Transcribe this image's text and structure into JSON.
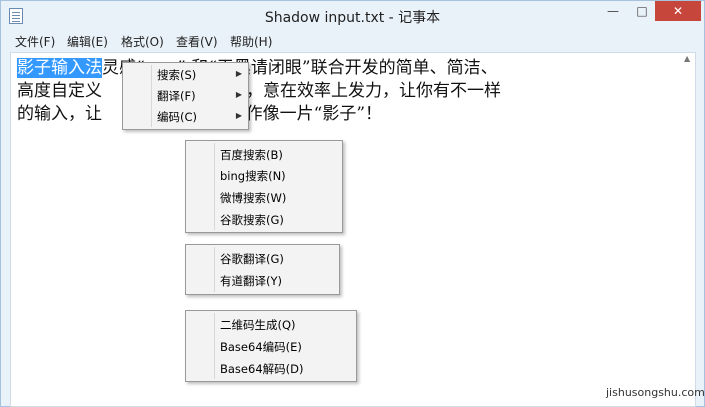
{
  "window": {
    "title": "Shadow input.txt - 记事本",
    "minimize": "—",
    "maximize": "□",
    "close": "✕"
  },
  "menubar": {
    "items": [
      "文件(F)",
      "编辑(E)",
      "格式(O)",
      "查看(V)",
      "帮助(H)"
    ]
  },
  "editor": {
    "selected_text": "影子输入法",
    "line1_rest": "灵感“      ” 和“天黑请闭眼”联合开发的简单、简洁、",
    "line2": "高度自定义              名“影子”，意在效率上发力，让你有不一样",
    "line3": "的输入，让              让你的操作像一片“影子”！"
  },
  "context_menu": {
    "items": [
      "搜索(S)",
      "翻译(F)",
      "编码(C)"
    ]
  },
  "submenu_search": {
    "items": [
      "百度搜索(B)",
      "bing搜索(N)",
      "微博搜索(W)",
      "谷歌搜索(G)"
    ]
  },
  "submenu_translate": {
    "items": [
      "谷歌翻译(G)",
      "有道翻译(Y)"
    ]
  },
  "submenu_encode": {
    "items": [
      "二维码生成(Q)",
      "Base64编码(E)",
      "Base64解码(D)"
    ]
  },
  "watermark": "jishusongshu.com"
}
